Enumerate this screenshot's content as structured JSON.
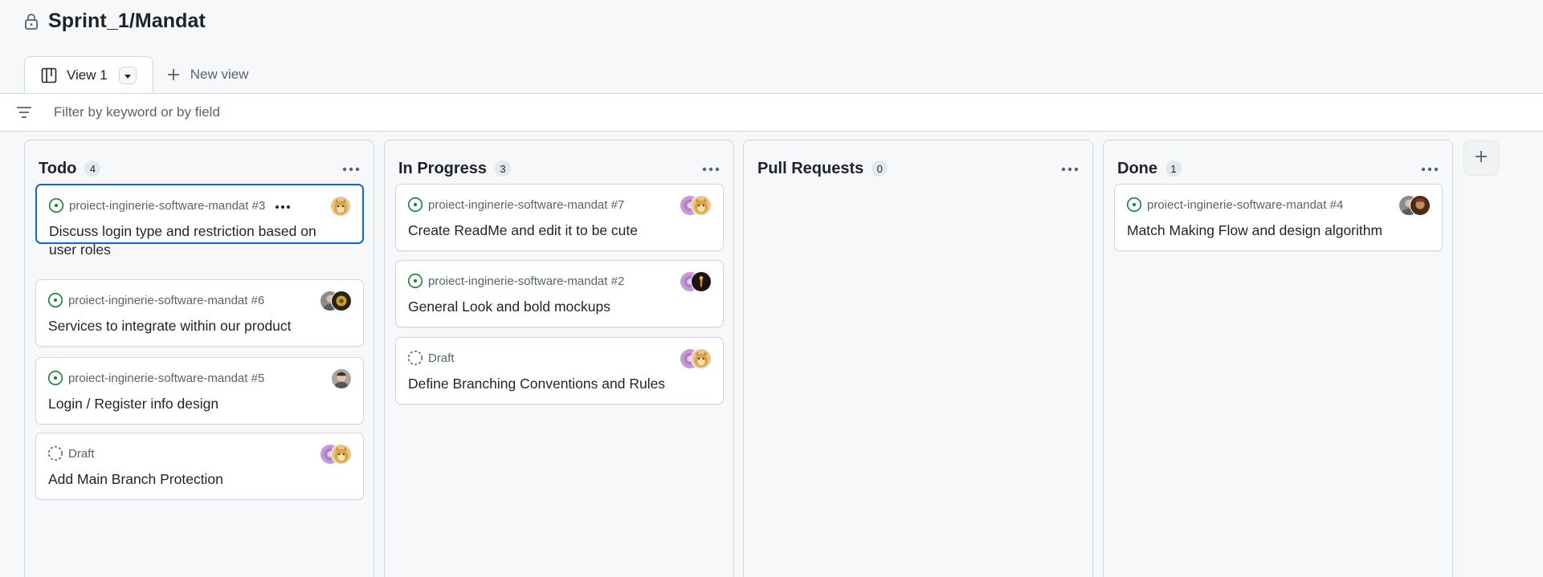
{
  "header": {
    "title": "Sprint_1/Mandat",
    "lock_icon": "lock-icon"
  },
  "tabs": [
    {
      "label": "View 1",
      "icon": "board-icon",
      "active": true
    },
    {
      "label": "New view",
      "icon": "plus-icon",
      "active": false
    }
  ],
  "filter": {
    "placeholder": "Filter by keyword or by field",
    "value": ""
  },
  "colors": {
    "accent": "#0969da",
    "open_issue": "#1a7f37",
    "draft": "#59636e",
    "border": "#d0d7de"
  },
  "columns": [
    {
      "title": "Todo",
      "count": "4",
      "cards": [
        {
          "meta": "proiect-inginerie-software-mandat #3",
          "status": "open",
          "title": "Discuss login type and restriction based on user roles",
          "avatars": [
            "doge"
          ],
          "selected": true
        },
        {
          "meta": "proiect-inginerie-software-mandat #6",
          "status": "open",
          "title": "Services to integrate within our product",
          "avatars": [
            "gray-person",
            "dark-gold"
          ],
          "selected": false
        },
        {
          "meta": "proiect-inginerie-software-mandat #5",
          "status": "open",
          "title": "Login / Register info design",
          "avatars": [
            "person"
          ],
          "selected": false
        },
        {
          "meta": "Draft",
          "status": "draft",
          "title": "Add Main Branch Protection",
          "avatars": [
            "purple",
            "doge"
          ],
          "selected": false
        }
      ]
    },
    {
      "title": "In Progress",
      "count": "3",
      "cards": [
        {
          "meta": "proiect-inginerie-software-mandat #7",
          "status": "open",
          "title": "Create ReadMe and edit it to be cute",
          "avatars": [
            "purple",
            "doge"
          ]
        },
        {
          "meta": "proiect-inginerie-software-mandat #2",
          "status": "open",
          "title": "General Look and bold mockups",
          "avatars": [
            "purple",
            "dark"
          ]
        },
        {
          "meta": "Draft",
          "status": "draft",
          "title": "Define Branching Conventions and Rules",
          "avatars": [
            "purple",
            "doge"
          ]
        }
      ]
    },
    {
      "title": "Pull Requests",
      "count": "0",
      "cards": []
    },
    {
      "title": "Done",
      "count": "1",
      "cards": [
        {
          "meta": "proiect-inginerie-software-mandat #4",
          "status": "open",
          "title": "Match Making Flow and design algorithm",
          "avatars": [
            "gray-person",
            "brown"
          ]
        }
      ]
    }
  ]
}
